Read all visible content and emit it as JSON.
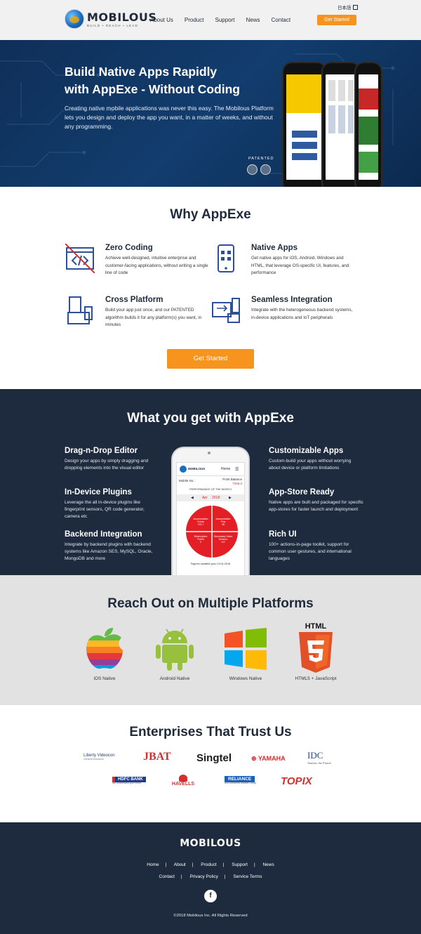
{
  "header": {
    "brand": "MOBILOUS",
    "tagline": "BUILD • REACH • LEAD",
    "nav": [
      "About Us",
      "Product",
      "Support",
      "News",
      "Contact"
    ],
    "lang": "日本語",
    "cta": "Get Started"
  },
  "hero": {
    "title_line1": "Build Native Apps Rapidly",
    "title_line2": "with AppExe - Without Coding",
    "subtitle": "Creating native mobile applications was never this easy. The Mobilous Platform lets you design and deploy the app you want, in a matter of weeks, and without any programming.",
    "patented": "PATENTED"
  },
  "why": {
    "title": "Why AppExe",
    "features": [
      {
        "title": "Zero Coding",
        "text": "Achieve well-designed, intuitive enterprise and customer-facing applications, without writing a single line of code"
      },
      {
        "title": "Native Apps",
        "text": "Get native apps for iOS, Android, Windows and HTML, that leverage OS-specific UI, features, and performance"
      },
      {
        "title": "Cross Platform",
        "text": "Build your app just once, and our PATENTED algorithm builds it for any platform(s) you want, in minutes"
      },
      {
        "title": "Seamless Integration",
        "text": "Integrate with the heterogeneous backend systems, in-device applications and IoT peripherals"
      }
    ],
    "cta": "Get Started"
  },
  "get": {
    "title": "What you get with AppExe",
    "left": [
      {
        "title": "Drag-n-Drop Editor",
        "text": "Design your apps by simply dragging and dropping elements into the visual editor"
      },
      {
        "title": "In-Device Plugins",
        "text": "Leverage the all in-device plugins like fingerprint sensors, QR code generator, camera etc"
      },
      {
        "title": "Backend Integration",
        "text": "Integrate by backend plugins with backend systems like Amazon SES, MySQL, Oracle, MongoDB and more"
      }
    ],
    "right": [
      {
        "title": "Customizable Apps",
        "text": "Custom-build your apps without worrying about device or platform limitations"
      },
      {
        "title": "App-Store Ready",
        "text": "Native apps are built and packaged for specific app-stores for faster launch and deployment"
      },
      {
        "title": "Rich UI",
        "text": "100+ actions-in-page toolkit, support for common user gestures, and international languages"
      }
    ],
    "phone": {
      "home": "Home",
      "mobile_no": "Mobile No.:",
      "point_balance": "Point Balance",
      "balance": "7346.2",
      "perf": "PERFORMANCE OF THE MONTH",
      "month": "Apr",
      "year": "2018",
      "q1": "Accumulation Points",
      "q1v": "722.7",
      "q2": "Accumulation Pins",
      "q2v": "38",
      "q3": "Redemption Points",
      "q3v": "0",
      "q4": "Secondary Sales Sensors",
      "q4v": "0.0",
      "updated": "Figures updated upto 13-04-2018"
    }
  },
  "platforms": {
    "title": "Reach Out on Multiple Platforms",
    "items": [
      "iOS Native",
      "Android Native",
      "Windows Native",
      "HTML5 + JavaScript"
    ],
    "html_word": "HTML"
  },
  "enterprises": {
    "title": "Enterprises That Trust Us",
    "logos": [
      "Liberty Videocon",
      "JBAT",
      "Singtel",
      "YAMAHA",
      "IDC",
      "HDFC BANK",
      "HAVELLS",
      "RELIANCE",
      "TOPIX"
    ],
    "idc_tag": "Analyze the Future",
    "hdfc_tag": "We understand your world",
    "reliance_tag": "Anil Dhirubhai Ambani Group",
    "liberty_tag": "General Insurance"
  },
  "footer": {
    "brand": "MOBILOUS",
    "row1": [
      "Home",
      "About",
      "Product",
      "Support",
      "News"
    ],
    "row2": [
      "Contact",
      "Privacy Policy",
      "Service Terms"
    ],
    "fb": "f",
    "copyright": "©2018 Mobilous Inc. All Rights Reserved"
  },
  "colors": {
    "accent": "#f7941d",
    "dark": "#1e2b3e",
    "hero": "#123d6e"
  }
}
